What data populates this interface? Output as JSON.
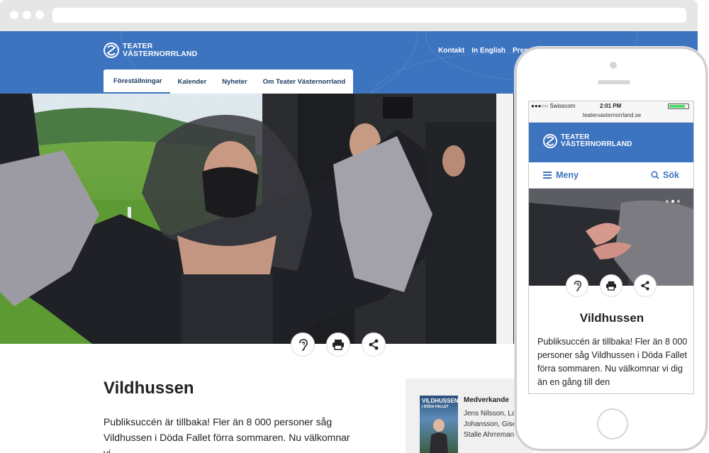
{
  "site": {
    "logo_line1": "TEATER",
    "logo_line2": "VÄSTERNORRLAND",
    "top_links": [
      "Kontakt",
      "In English",
      "Press"
    ],
    "tabs": [
      "Föreställningar",
      "Kalender",
      "Nyheter",
      "Om Teater Västernorrland"
    ],
    "accent": "#3d74c0"
  },
  "article": {
    "title": "Vildhussen",
    "intro_line1": "Publiksuccén är tillbaka! Fler än 8 000 personer såg",
    "intro_line2": "Vildhussen i Döda Fallet förra sommaren. Nu välkomnar vi"
  },
  "actions": {
    "listen_icon": "ear-icon",
    "print_icon": "print-icon",
    "share_icon": "share-icon"
  },
  "sidebar": {
    "poster_title_1": "VILDHUSSEN",
    "poster_title_2": "I DÖDA FALLET",
    "heading": "Medverkande",
    "names": [
      "Jens Nilsson, La",
      "Johansson, Gise",
      "Stalle Ahrreman"
    ]
  },
  "mobile": {
    "carrier": "●●●○○ Swisscom",
    "time": "2:01 PM",
    "url": "teatervasternorrland.se",
    "logo_line1": "TEATER",
    "logo_line2": "VÄSTERNORRLAND",
    "menu_label": "Meny",
    "search_label": "Sök",
    "title": "Vildhussen",
    "text": "Publiksuccén är tillbaka! Fler än 8 000 personer såg Vildhussen i Döda Fallet förra sommaren. Nu välkomnar vi dig än en gång till den"
  }
}
